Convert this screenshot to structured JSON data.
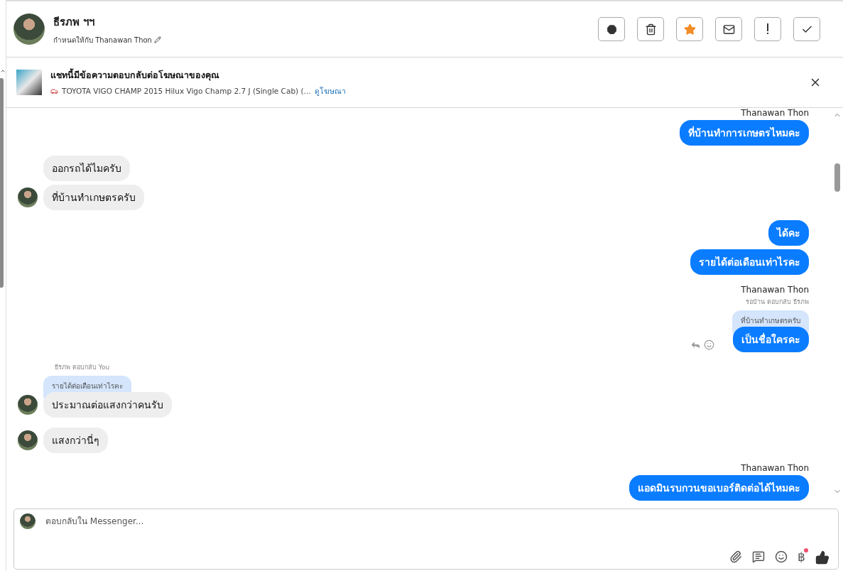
{
  "contact": {
    "name": "ธีรภพ ฯฯ",
    "assigned": "กำหนดให้กับ Thanawan Thon"
  },
  "actions": [
    {
      "kind": "alert",
      "active": false
    },
    {
      "kind": "trash",
      "active": false
    },
    {
      "kind": "star",
      "active": true
    },
    {
      "kind": "mail",
      "active": false
    },
    {
      "kind": "exclaim",
      "active": false
    },
    {
      "kind": "check",
      "active": false
    }
  ],
  "ad_banner": {
    "title": "แชทนี้มีข้อความตอบกลับต่อโฆษณาของคุณ",
    "subtitle": "TOYOTA VIGO CHAMP 2015 Hilux Vigo Champ 2.7 J (Single Cab) (...",
    "link": "ดูโฆษณา"
  },
  "messages": [
    {
      "kind": "outgoing",
      "sender": "Thanawan Thon",
      "bubbles": [
        "ที่บ้านทำการเกษตรไหมคะ"
      ]
    },
    {
      "kind": "incoming",
      "bubbles": [
        "ออกรถได้ไมครับ",
        "ที่บ้านทำเกษตรครับ"
      ]
    },
    {
      "kind": "outgoing",
      "bubbles": [
        "ได้คะ",
        "รายได้ต่อเดือนเท่าไรคะ"
      ]
    },
    {
      "kind": "outgoing",
      "sender": "Thanawan Thon",
      "reply_label": "รอบ้าน ตอบกลับ ธีรภพ",
      "quote": "ที่บ้านทำเกษตรครับ",
      "bubbles": [
        "เป็นชื่อใครคะ"
      ],
      "hovered": true
    },
    {
      "kind": "incoming",
      "reply_label": "ธีรภพ ตอบกลับ You",
      "quote": "รายได้ต่อเดือนเท่าไรคะ",
      "bubbles": [
        "ประมาณต่อแสงกว่าคนรับ"
      ]
    },
    {
      "kind": "incoming",
      "bubbles": [
        "แสงกว่านี่ๆ"
      ]
    },
    {
      "kind": "outgoing",
      "sender": "Thanawan Thon",
      "bubbles": [
        "แอดมินรบกวนขอเบอร์ติดต่อได้ไหมคะ"
      ]
    }
  ],
  "composer": {
    "placeholder": "ตอบกลับใน Messenger...",
    "tools": [
      {
        "kind": "attach",
        "badge": false
      },
      {
        "kind": "saved-reply",
        "badge": false
      },
      {
        "kind": "emoji",
        "badge": false
      },
      {
        "kind": "baht",
        "label": "฿",
        "badge": true
      },
      {
        "kind": "like",
        "badge": false
      }
    ]
  }
}
